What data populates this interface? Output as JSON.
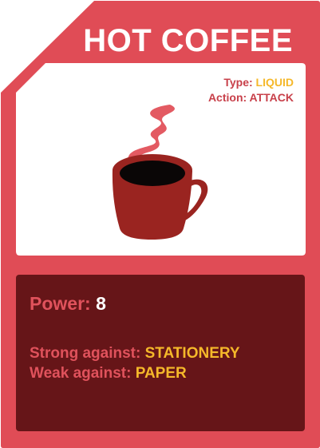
{
  "card": {
    "name": "HOT COFFEE",
    "type_label": "Type:",
    "type_value": "LIQUID",
    "action_label": "Action:",
    "action_value": "ATTACK",
    "illustration_icon": "hot-coffee-cup-icon",
    "power_label": "Power:",
    "power_value": "8",
    "strong_label": "Strong against:",
    "strong_value": "STATIONERY",
    "weak_label": "Weak against:",
    "weak_value": "PAPER"
  },
  "colors": {
    "frame": "#e04c56",
    "panel_dark": "#661518",
    "label_red": "#e0525c",
    "accent_yellow": "#f5b82a",
    "cup": "#9a2420",
    "steam": "#e35a62"
  }
}
